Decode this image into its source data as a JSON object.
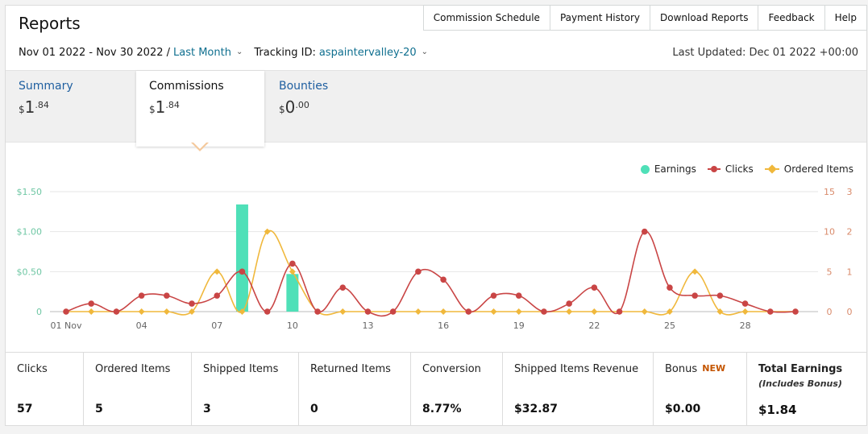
{
  "header": {
    "title": "Reports",
    "nav": [
      "Commission Schedule",
      "Payment History",
      "Download Reports",
      "Feedback",
      "Help"
    ],
    "date_range": "Nov 01 2022 - Nov 30 2022 /",
    "period": "Last Month",
    "tracking_label": "Tracking ID:",
    "tracking_id": "aspaintervalley-20",
    "last_updated": "Last Updated: Dec 01 2022 +00:00"
  },
  "tabs": {
    "summary": {
      "label": "Summary",
      "currency": "$",
      "whole": "1",
      "cents": ".84"
    },
    "commissions": {
      "label": "Commissions",
      "currency": "$",
      "whole": "1",
      "cents": ".84"
    },
    "bounties": {
      "label": "Bounties",
      "currency": "$",
      "whole": "0",
      "cents": ".00"
    }
  },
  "legend": {
    "earnings": "Earnings",
    "clicks": "Clicks",
    "ordered": "Ordered Items"
  },
  "colors": {
    "earnings": "#4fe0b8",
    "clicks": "#c94545",
    "ordered": "#f0b83c",
    "link": "#0f6f8f",
    "new": "#c45500"
  },
  "chart_data": {
    "type": "bar+line",
    "x": [
      1,
      2,
      3,
      4,
      5,
      6,
      7,
      8,
      9,
      10,
      11,
      12,
      13,
      14,
      15,
      16,
      17,
      18,
      19,
      20,
      21,
      22,
      23,
      24,
      25,
      26,
      27,
      28,
      29,
      30
    ],
    "x_tick_labels": [
      "01 Nov",
      "04",
      "07",
      "10",
      "13",
      "16",
      "19",
      "22",
      "25",
      "28"
    ],
    "x_tick_positions": [
      1,
      4,
      7,
      10,
      13,
      16,
      19,
      22,
      25,
      28
    ],
    "y_left": {
      "ticks": [
        "$1.50",
        "$1.00",
        "$0.50",
        "0"
      ],
      "values": [
        1.5,
        1.0,
        0.5,
        0
      ],
      "ylim": [
        0,
        1.5
      ]
    },
    "y_right_clicks": {
      "ticks": [
        "15",
        "10",
        "5",
        "0"
      ],
      "values": [
        15,
        10,
        5,
        0
      ],
      "ylim": [
        0,
        15
      ]
    },
    "y_right_ordered": {
      "ticks": [
        "3",
        "2",
        "1",
        "0"
      ],
      "values": [
        3,
        2,
        1,
        0
      ],
      "ylim": [
        0,
        3
      ]
    },
    "series": [
      {
        "name": "Earnings",
        "kind": "bar",
        "axis": "left",
        "values": [
          0,
          0,
          0,
          0,
          0,
          0,
          0,
          1.34,
          0,
          0.47,
          0,
          0,
          0,
          0,
          0,
          0,
          0,
          0,
          0,
          0,
          0,
          0,
          0,
          0,
          0,
          0,
          0,
          0,
          0,
          0
        ]
      },
      {
        "name": "Clicks",
        "kind": "line",
        "axis": "right_clicks",
        "values": [
          0,
          1,
          0,
          2,
          2,
          1,
          2,
          5,
          0,
          6,
          0,
          3,
          0,
          0,
          5,
          4,
          0,
          2,
          2,
          0,
          1,
          3,
          0,
          10,
          3,
          2,
          2,
          1,
          0,
          0
        ]
      },
      {
        "name": "Ordered Items",
        "kind": "line",
        "axis": "right_ordered",
        "values": [
          0,
          0,
          0,
          0,
          0,
          0,
          1,
          0,
          2,
          1,
          0,
          0,
          0,
          0,
          0,
          0,
          0,
          0,
          0,
          0,
          0,
          0,
          0,
          0,
          0,
          1,
          0,
          0,
          0,
          0
        ]
      }
    ]
  },
  "stats": [
    {
      "label": "Clicks",
      "value": "57"
    },
    {
      "label": "Ordered Items",
      "value": "5"
    },
    {
      "label": "Shipped Items",
      "value": "3"
    },
    {
      "label": "Returned Items",
      "value": "0"
    },
    {
      "label": "Conversion",
      "value": "8.77%"
    },
    {
      "label": "Shipped Items Revenue",
      "value": "$32.87"
    },
    {
      "label": "Bonus",
      "badge": "NEW",
      "value": "$0.00"
    },
    {
      "label": "Total Earnings",
      "sublabel": "(Includes Bonus)",
      "value": "$1.84"
    }
  ]
}
